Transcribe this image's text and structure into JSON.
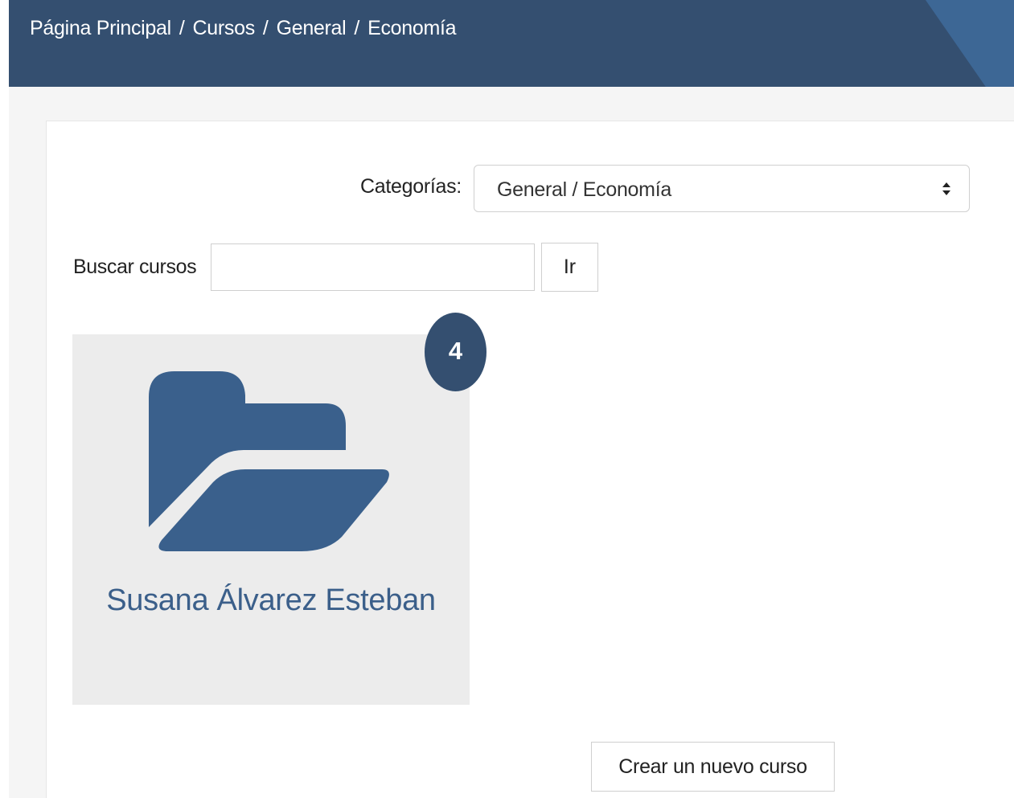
{
  "breadcrumb": {
    "items": [
      "Página Principal",
      "Cursos",
      "General",
      "Economía"
    ],
    "separator": "/"
  },
  "category_filter": {
    "label": "Categorías:",
    "selected": "General / Economía",
    "arrow_icon": "sort-arrows-icon"
  },
  "search": {
    "label": "Buscar cursos",
    "value": "",
    "placeholder": "",
    "button_label": "Ir"
  },
  "category_tile": {
    "name": "Susana Álvarez Esteban",
    "count": "4",
    "icon": "folder-open-icon"
  },
  "actions": {
    "create_course_label": "Crear un nuevo curso"
  },
  "colors": {
    "header_bg": "#344f70",
    "accent": "#3b5f8a",
    "tile_bg": "#ececec"
  }
}
